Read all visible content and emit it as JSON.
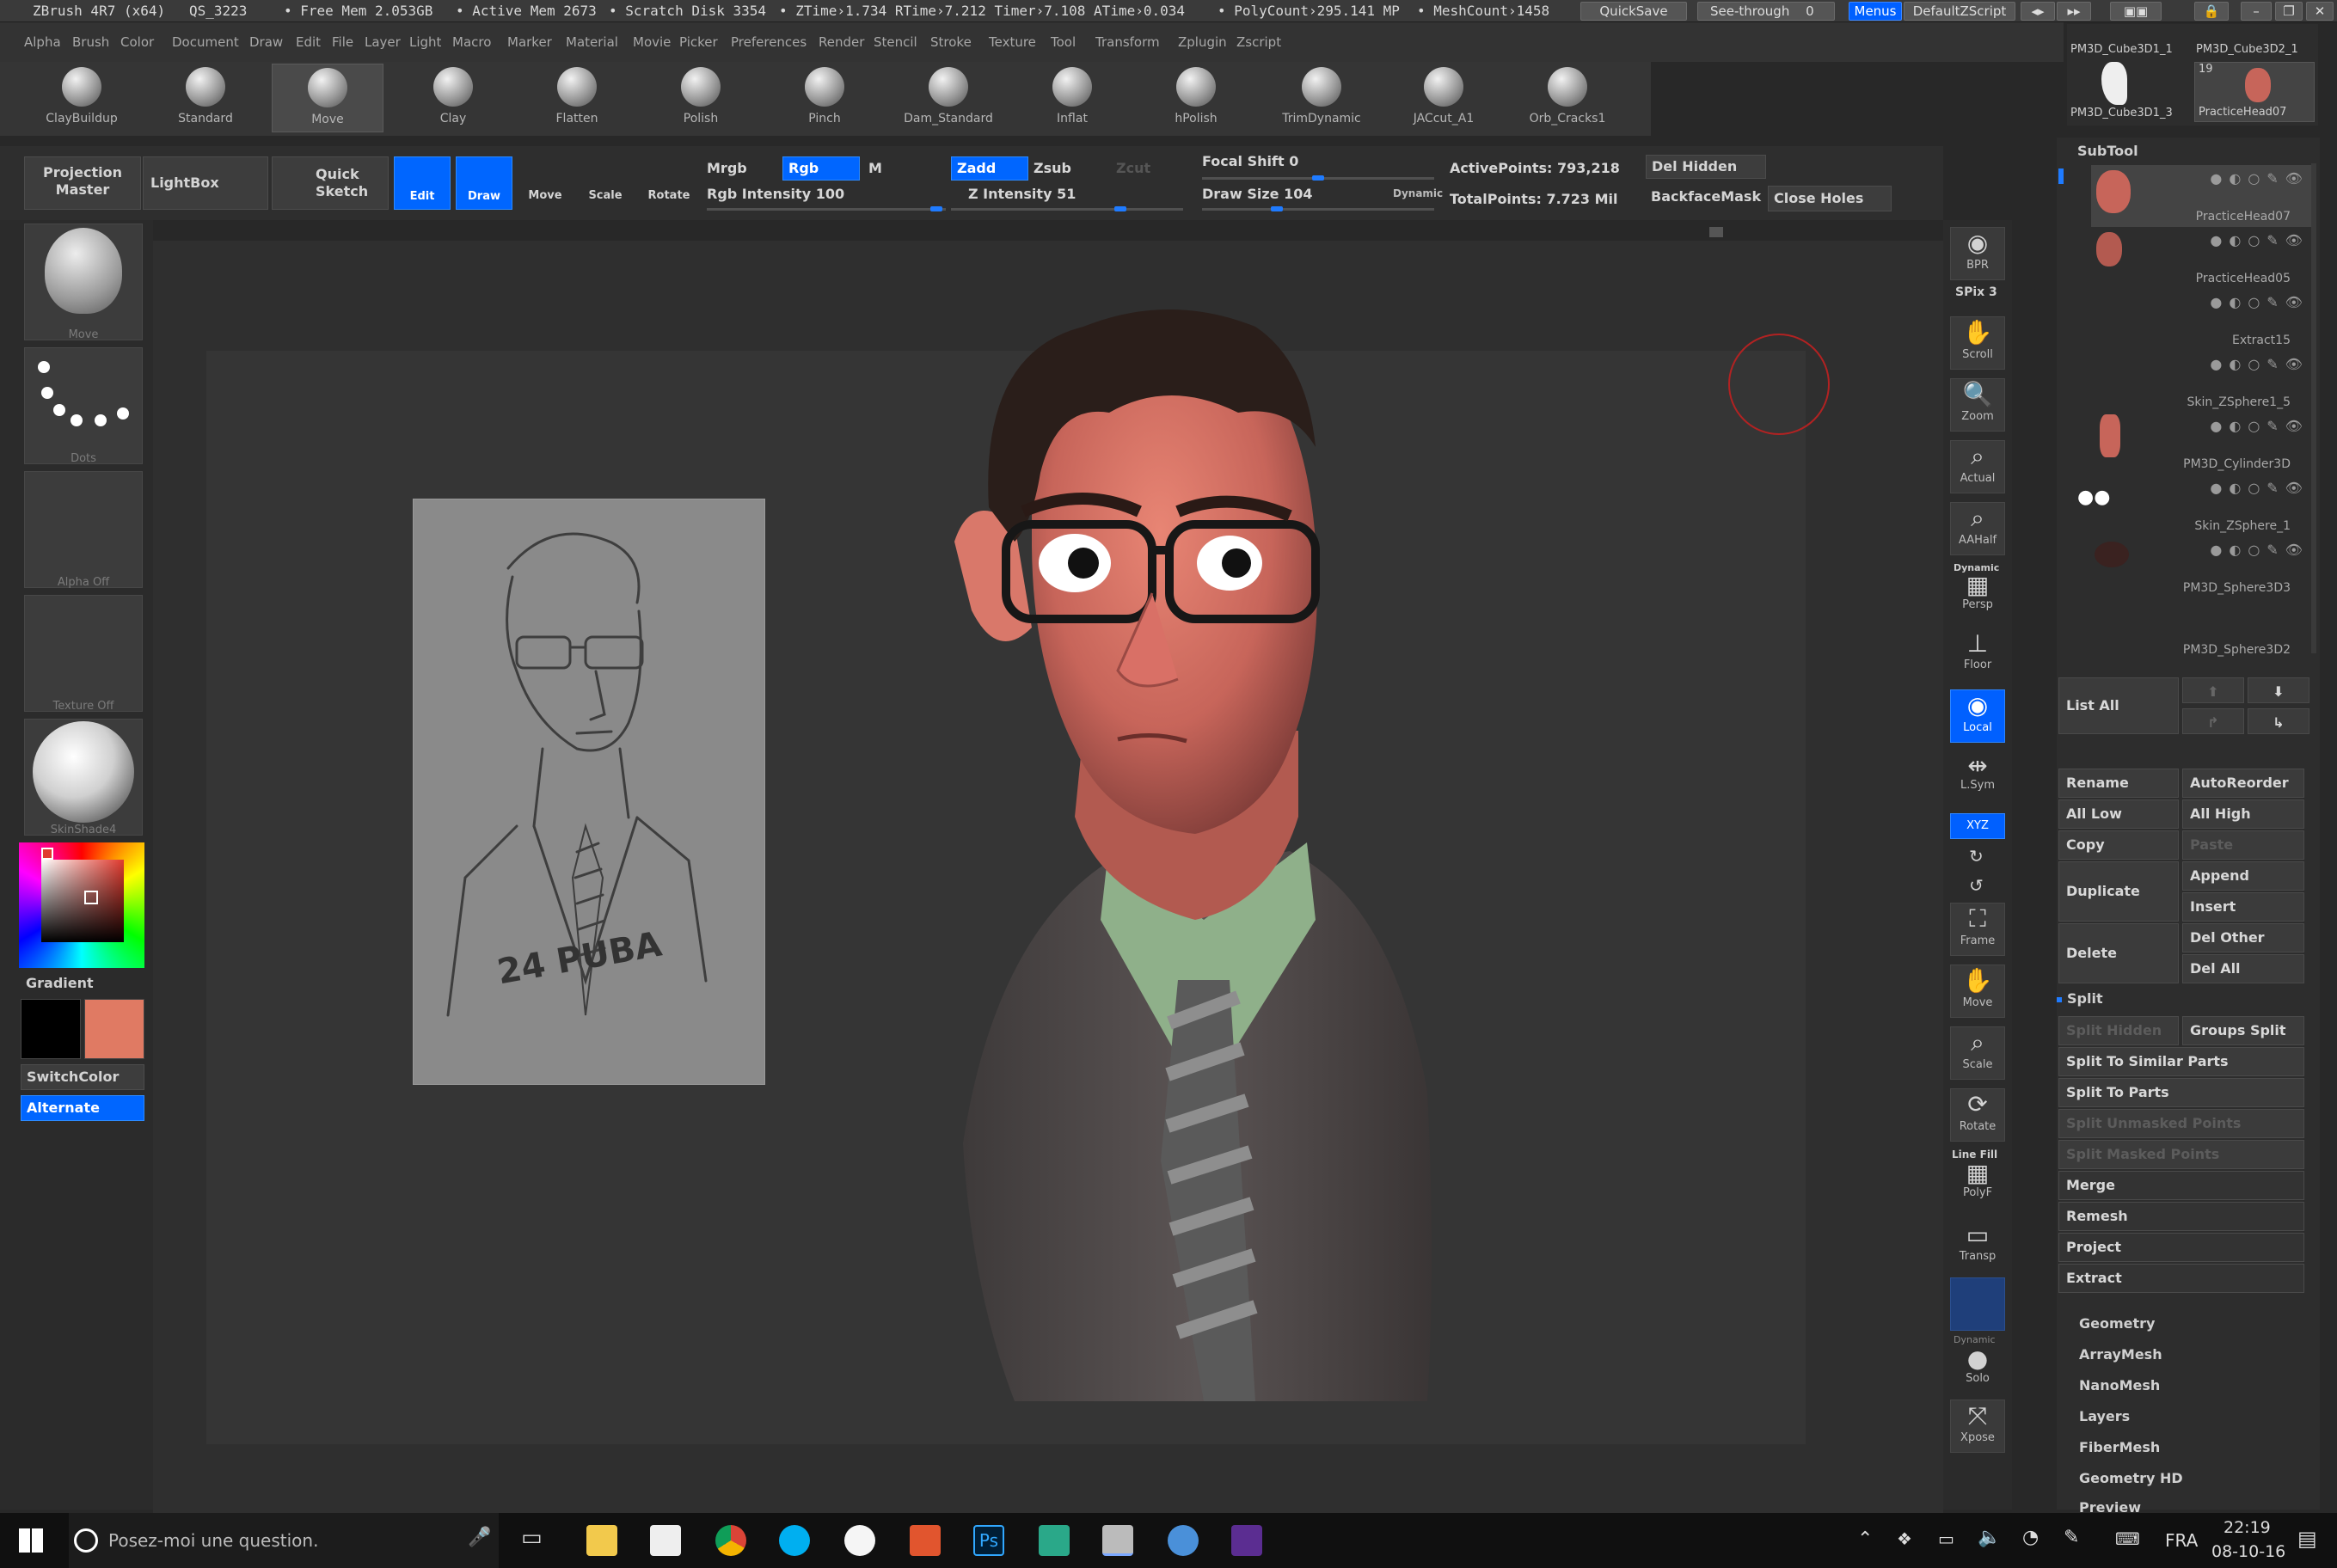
{
  "title_bar": {
    "app": "ZBrush 4R7 (x64)",
    "qs": "QS_3223",
    "free_mem": "• Free Mem 2.053GB",
    "active_mem": "• Active Mem 2673",
    "scratch": "• Scratch Disk 3354",
    "timers": "• ZTime›1.734 RTime›7.212 Timer›7.108 ATime›0.034",
    "polycount": "• PolyCount›295.141 MP",
    "meshcount": "• MeshCount›1458",
    "quicksave": "QuickSave",
    "seethrough": "See-through",
    "seethrough_val": "0",
    "menus": "Menus",
    "script": "DefaultZScript"
  },
  "menu": [
    "Alpha",
    "Brush",
    "Color",
    "Document",
    "Draw",
    "Edit",
    "File",
    "Layer",
    "Light",
    "Macro",
    "Marker",
    "Material",
    "Movie",
    "Picker",
    "Preferences",
    "Render",
    "Stencil",
    "Stroke",
    "Texture",
    "Tool",
    "Transform",
    "Zplugin",
    "Zscript"
  ],
  "brushes": [
    "ClayBuildup",
    "Standard",
    "Move",
    "Clay",
    "Flatten",
    "Polish",
    "Pinch",
    "Dam_Standard",
    "Inflat",
    "hPolish",
    "TrimDynamic",
    "JACcut_A1",
    "Orb_Cracks1"
  ],
  "top_palette": {
    "projection_master": "Projection Master",
    "lightbox": "LightBox",
    "quick_sketch": "Quick Sketch",
    "edit": "Edit",
    "draw": "Draw",
    "move": "Move",
    "scale": "Scale",
    "rotate": "Rotate",
    "mrgb": "Mrgb",
    "rgb": "Rgb",
    "m": "M",
    "zadd": "Zadd",
    "zsub": "Zsub",
    "zcut": "Zcut",
    "rgb_intensity": "Rgb Intensity 100",
    "z_intensity": "Z Intensity 51",
    "focal_shift": "Focal Shift 0",
    "draw_size": "Draw Size 104",
    "dynamic": "Dynamic",
    "active_points": "ActivePoints: 793,218",
    "total_points": "TotalPoints: 7.723 Mil",
    "del_hidden": "Del Hidden",
    "backface_mask": "BackfaceMask",
    "close_holes": "Close Holes"
  },
  "left_shelf": {
    "move": "Move",
    "dots": "Dots",
    "alpha_off": "Alpha Off",
    "texture_off": "Texture Off",
    "material": "SkinShade4",
    "gradient": "Gradient",
    "switchcolor": "SwitchColor",
    "alternate": "Alternate",
    "main_color": "#e07a63",
    "secondary_color": "#000000"
  },
  "sketch_text": "24 PUBA",
  "right_tools": [
    {
      "icon": "bpr-icon",
      "label": "BPR"
    },
    {
      "icon": "scroll-icon",
      "label": "Scroll"
    },
    {
      "icon": "zoom-icon",
      "label": "Zoom"
    },
    {
      "icon": "actual-icon",
      "label": "Actual"
    },
    {
      "icon": "aahalf-icon",
      "label": "AAHalf"
    },
    {
      "icon": "persp-icon",
      "label": "Persp"
    },
    {
      "icon": "floor-icon",
      "label": "Floor"
    },
    {
      "icon": "local-icon",
      "label": "Local"
    },
    {
      "icon": "lsym-icon",
      "label": "L.Sym"
    },
    {
      "icon": "xyz-icon",
      "label": "XYZ"
    },
    {
      "icon": "frame-icon",
      "label": "Frame"
    },
    {
      "icon": "move-icon",
      "label": "Move"
    },
    {
      "icon": "scale-icon",
      "label": "Scale"
    },
    {
      "icon": "rotate-icon",
      "label": "Rotate"
    },
    {
      "icon": "polyf-icon",
      "label": "PolyF"
    },
    {
      "icon": "transp-icon",
      "label": "Transp"
    },
    {
      "icon": "solo-icon",
      "label": "Solo"
    },
    {
      "icon": "xpose-icon",
      "label": "Xpose"
    }
  ],
  "spix": "SPix 3",
  "dynamic_label": "Dynamic",
  "line_fill": "Line Fill",
  "subtool": {
    "recent_tools": [
      "PM3D_Cube3D1_1",
      "PM3D_Cube3D2_1",
      "PM3D_Cube3D1_3",
      "PracticeHead07"
    ],
    "recent_count": "19",
    "title": "SubTool",
    "items": [
      "PracticeHead07",
      "PracticeHead05",
      "Extract15",
      "Skin_ZSphere1_5",
      "PM3D_Cylinder3D",
      "Skin_ZSphere_1",
      "PM3D_Sphere3D3",
      "PM3D_Sphere3D2"
    ],
    "list_all": "List All",
    "buttons": {
      "rename": "Rename",
      "autoreorder": "AutoReorder",
      "all_low": "All Low",
      "all_high": "All High",
      "copy": "Copy",
      "paste": "Paste",
      "duplicate": "Duplicate",
      "append": "Append",
      "insert": "Insert",
      "delete": "Delete",
      "del_other": "Del Other",
      "del_all": "Del All",
      "split": "Split",
      "split_hidden": "Split Hidden",
      "groups_split": "Groups Split",
      "split_similar": "Split To Similar Parts",
      "split_parts": "Split To Parts",
      "split_unmasked": "Split Unmasked Points",
      "split_masked": "Split Masked Points",
      "merge": "Merge",
      "remesh": "Remesh",
      "project": "Project",
      "extract": "Extract"
    },
    "sections": [
      "Geometry",
      "ArrayMesh",
      "NanoMesh",
      "Layers",
      "FiberMesh",
      "Geometry HD",
      "Preview"
    ]
  },
  "taskbar": {
    "search": "Posez-moi une question.",
    "lang": "FRA",
    "time": "22:19",
    "date": "08-10-16"
  }
}
